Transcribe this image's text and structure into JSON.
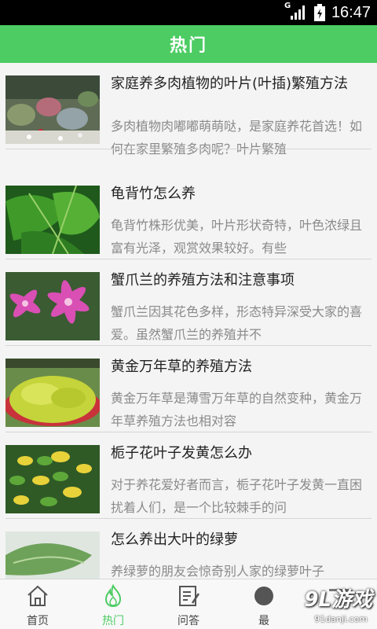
{
  "status_bar": {
    "network": "G",
    "time": "16:47"
  },
  "header": {
    "title": "热门"
  },
  "articles": [
    {
      "title": "家庭养多肉植物的叶片(叶插)繁殖方法",
      "summary": "多肉植物肉嘟嘟萌萌哒，是家庭养花首选！如何在家里繁殖多肉呢？叶片繁殖"
    },
    {
      "title": "龟背竹怎么养",
      "summary": "龟背竹株形优美，叶片形状奇特，叶色浓绿且富有光泽，观赏效果较好。有些"
    },
    {
      "title": "蟹爪兰的养殖方法和注意事项",
      "summary": "蟹爪兰因其花色多样，形态特异深受大家的喜爱。虽然蟹爪兰的养殖并不"
    },
    {
      "title": "黄金万年草的养殖方法",
      "summary": "黄金万年草是薄雪万年草的自然变种，黄金万年草养殖方法也相对容"
    },
    {
      "title": "栀子花叶子发黄怎么办",
      "summary": "对于养花爱好者而言，栀子花叶子发黄一直困扰着人们，是一个比较棘手的问"
    },
    {
      "title": "怎么养出大叶的绿萝",
      "summary": "养绿萝的朋友会惊奇别人家的绿萝叶子"
    }
  ],
  "tabs": [
    {
      "label": "首页",
      "icon": "home-icon"
    },
    {
      "label": "热门",
      "icon": "flame-icon",
      "active": true
    },
    {
      "label": "问答",
      "icon": "qa-icon"
    },
    {
      "label": "最",
      "icon": "newest-icon"
    },
    {
      "label": "",
      "icon": "more-icon"
    }
  ],
  "watermark": {
    "brand": "9L游戏",
    "url": "91danji.com"
  },
  "colors": {
    "accent": "#4ccc63",
    "title_text": "#222222",
    "summary_text": "#8a8a8a"
  }
}
